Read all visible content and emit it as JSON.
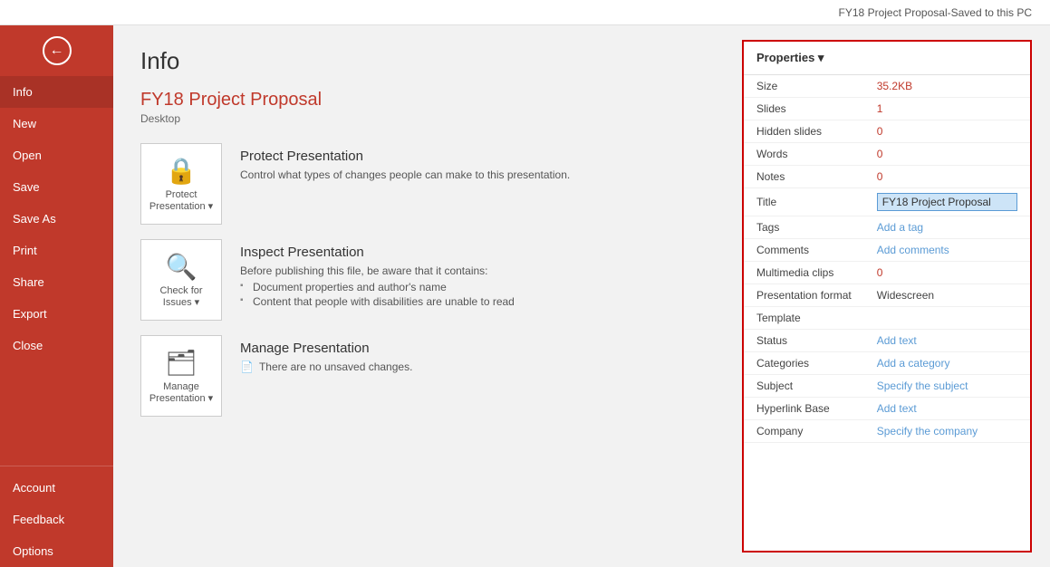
{
  "topbar": {
    "filename": "FY18 Project Proposal",
    "separator": " -  ",
    "save_status": "Saved to this PC"
  },
  "sidebar": {
    "back_label": "←",
    "items": [
      {
        "id": "info",
        "label": "Info",
        "active": true
      },
      {
        "id": "new",
        "label": "New"
      },
      {
        "id": "open",
        "label": "Open"
      },
      {
        "id": "save",
        "label": "Save"
      },
      {
        "id": "save-as",
        "label": "Save As"
      },
      {
        "id": "print",
        "label": "Print"
      },
      {
        "id": "share",
        "label": "Share"
      },
      {
        "id": "export",
        "label": "Export"
      },
      {
        "id": "close",
        "label": "Close"
      }
    ],
    "bottom_items": [
      {
        "id": "account",
        "label": "Account"
      },
      {
        "id": "feedback",
        "label": "Feedback"
      },
      {
        "id": "options",
        "label": "Options"
      }
    ]
  },
  "info": {
    "page_title": "Info",
    "file_title": "FY18 Project Proposal",
    "file_location": "Desktop"
  },
  "protect_card": {
    "icon": "🔒",
    "icon_label": "Protect\nPresentation ▾",
    "title": "Protect Presentation",
    "desc": "Control what types of changes people can make to this presentation."
  },
  "inspect_card": {
    "icon": "🔍",
    "icon_label": "Check for\nIssues ▾",
    "title": "Inspect Presentation",
    "desc": "Before publishing this file, be aware that it contains:",
    "bullets": [
      "Document properties and author's name",
      "Content that people with disabilities are unable to read"
    ]
  },
  "manage_card": {
    "icon": "🗂",
    "icon_label": "Manage\nPresentation ▾",
    "title": "Manage Presentation",
    "no_changes": "There are no unsaved changes."
  },
  "properties": {
    "header": "Properties ▾",
    "rows": [
      {
        "label": "Size",
        "value": "35.2KB",
        "type": "orange"
      },
      {
        "label": "Slides",
        "value": "1",
        "type": "orange"
      },
      {
        "label": "Hidden slides",
        "value": "0",
        "type": "orange"
      },
      {
        "label": "Words",
        "value": "0",
        "type": "orange"
      },
      {
        "label": "Notes",
        "value": "0",
        "type": "orange"
      },
      {
        "label": "Title",
        "value": "FY18 Project Proposal",
        "type": "input"
      },
      {
        "label": "Tags",
        "value": "Add a tag",
        "type": "link"
      },
      {
        "label": "Comments",
        "value": "Add comments",
        "type": "link"
      },
      {
        "label": "Multimedia clips",
        "value": "0",
        "type": "orange"
      },
      {
        "label": "Presentation format",
        "value": "Widescreen",
        "type": "plain"
      },
      {
        "label": "Template",
        "value": "",
        "type": "plain"
      },
      {
        "label": "Status",
        "value": "Add text",
        "type": "link"
      },
      {
        "label": "Categories",
        "value": "Add a category",
        "type": "link"
      },
      {
        "label": "Subject",
        "value": "Specify the subject",
        "type": "link"
      },
      {
        "label": "Hyperlink Base",
        "value": "Add text",
        "type": "link"
      },
      {
        "label": "Company",
        "value": "Specify the company",
        "type": "link"
      }
    ]
  }
}
